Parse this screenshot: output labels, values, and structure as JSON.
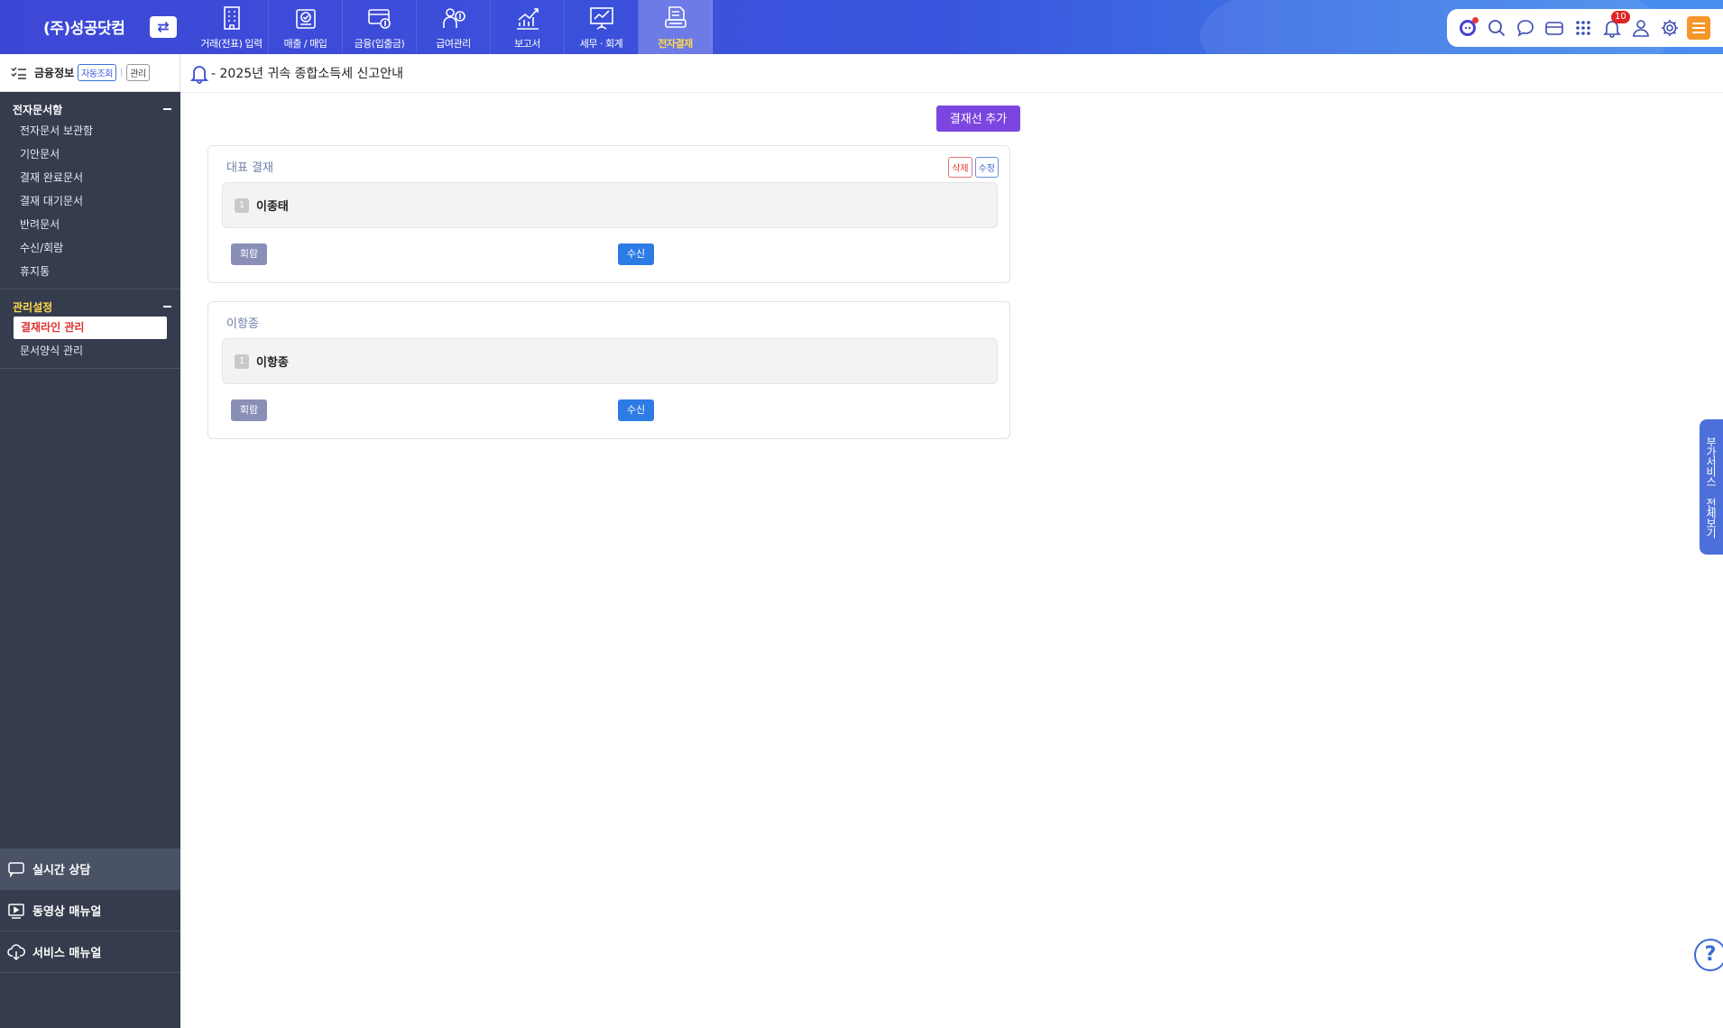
{
  "header": {
    "company": "(주)성공닷컴",
    "switch_icon": "⇄",
    "nav": [
      {
        "label": "거래(전표) 입력",
        "icon": "building-icon"
      },
      {
        "label": "매출 / 매입",
        "icon": "clipboard-check-icon"
      },
      {
        "label": "금융(입출금)",
        "icon": "card-coin-icon"
      },
      {
        "label": "급여관리",
        "icon": "person-coin-icon"
      },
      {
        "label": "보고서",
        "icon": "chart-up-icon"
      },
      {
        "label": "세무 · 회계",
        "icon": "presentation-icon"
      },
      {
        "label": "전자결재",
        "icon": "document-approval-icon"
      }
    ],
    "active_nav": "전자결재",
    "notification_count": "10"
  },
  "sidebar": {
    "finance": {
      "title": "금융정보",
      "auto_label": "자동조회",
      "manage_label": "관리"
    },
    "groups": [
      {
        "title": "전자문서함",
        "items": [
          "전자문서 보관함",
          "기안문서",
          "결재 완료문서",
          "결재 대기문서",
          "반려문서",
          "수신/회람",
          "휴지통"
        ]
      },
      {
        "title": "관리설정",
        "items": [
          "결재라인 관리",
          "문서양식 관리"
        ]
      }
    ],
    "active_item": "결재라인 관리",
    "bottom": [
      {
        "label": "실시간 상담",
        "icon": "chat-icon"
      },
      {
        "label": "동영상 매뉴얼",
        "icon": "video-icon"
      },
      {
        "label": "서비스 매뉴얼",
        "icon": "cloud-download-icon"
      }
    ]
  },
  "notice": {
    "text": "- 2025년 귀속 종합소득세 신고안내"
  },
  "main": {
    "add_button": "결재선 추가",
    "cards": [
      {
        "title": "대표 결재",
        "delete_label": "삭제",
        "edit_label": "수정",
        "approvers": [
          {
            "order": "1",
            "name": "이종태"
          }
        ],
        "circulate_label": "회람",
        "receive_label": "수신"
      },
      {
        "title": "이항종",
        "approvers": [
          {
            "order": "1",
            "name": "이항종"
          }
        ],
        "circulate_label": "회람",
        "receive_label": "수신"
      }
    ]
  },
  "right_tab": {
    "label": "부가서비스 전체보기"
  },
  "help": {
    "label": "?"
  },
  "colors": {
    "topbar": "#3d47d6",
    "sidebar": "#353c4d",
    "accent_purple": "#7b46e0",
    "active_yellow": "#ffd84a",
    "receive_blue": "#2d7be5"
  }
}
